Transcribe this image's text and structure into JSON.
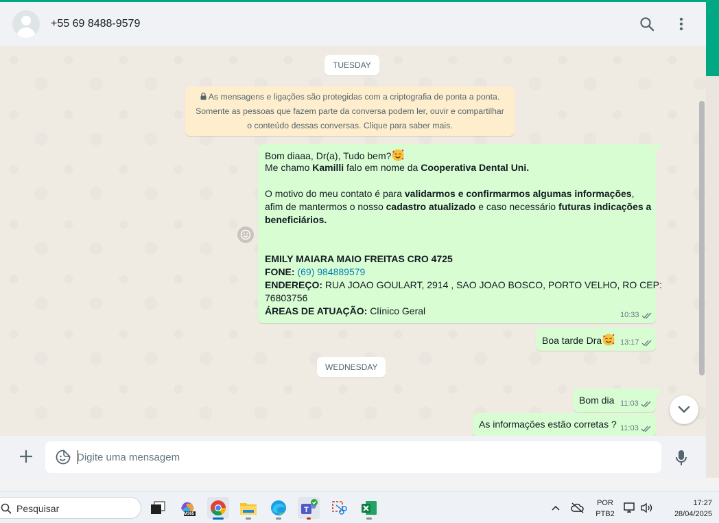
{
  "colors": {
    "accent": "#00a884",
    "outgoing_bubble": "#d9fdd3",
    "notice_bg": "#ffeecd",
    "chat_bg": "#efeae2",
    "link": "#027eb5"
  },
  "header": {
    "contact_name": "+55 69 8488-9579",
    "icons": [
      "avatar",
      "search-icon",
      "menu-icon"
    ]
  },
  "chat": {
    "date_chips": [
      "TUESDAY",
      "WEDNESDAY"
    ],
    "encryption_notice": {
      "line1": "As mensagens e ligações são protegidas com a criptografia de ponta a ponta.",
      "line2": "Somente as pessoas que fazem parte da conversa podem ler, ouvir e compartilhar",
      "line3": "o conteúdo dessas conversas. Clique para saber mais."
    },
    "messages": {
      "m1": {
        "greeting": "Bom diaaa, Dr(a), Tudo bem?",
        "intro_a": "Me chamo ",
        "intro_name": "Kamilli",
        "intro_b": " falo em nome da ",
        "intro_org": "Cooperativa Dental Uni.",
        "motive_a": "O motivo do meu contato é para ",
        "motive_bold": "validarmos e confirmarmos algumas informações",
        "motive_comma": ",",
        "motive2_a": "afim de mantermos o nosso ",
        "motive2_bold1": "cadastro atualizado",
        "motive2_b": " e caso necessário ",
        "motive2_bold2": "futuras indicações a",
        "motive3": "beneficiários.",
        "doctor": "EMILY MAIARA MAIO FREITAS CRO 4725",
        "phone_label": "FONE:",
        "phone_value": "(69) 984889579",
        "address_label": "ENDEREÇO:",
        "address_value": "RUA JOAO GOULART, 2914 , SAO JOAO BOSCO, PORTO VELHO, RO CEP:",
        "address_cont": "76803756",
        "areas_label": "ÁREAS DE ATUAÇÃO:",
        "areas_value": "Clínico Geral",
        "time": "10:33"
      },
      "m2": {
        "text": "Boa tarde Dra",
        "time": "13:17"
      },
      "m3": {
        "text": "Bom dia",
        "time": "11:03"
      },
      "m4": {
        "text": "As informações estão corretas ?",
        "time": "11:03"
      }
    }
  },
  "footer": {
    "input_placeholder": "Digite uma mensagem",
    "icons": [
      "plus-icon",
      "sticker-icon",
      "mic-icon"
    ]
  },
  "taskbar": {
    "search_placeholder": "Pesquisar",
    "apps": [
      "task-view",
      "m365",
      "chrome",
      "file-explorer",
      "edge",
      "teams",
      "snipping-tool",
      "excel"
    ],
    "m365_label": "M365",
    "lang_top": "POR",
    "lang_bottom": "PTB2",
    "time": "17:27",
    "date": "28/04/2025"
  }
}
